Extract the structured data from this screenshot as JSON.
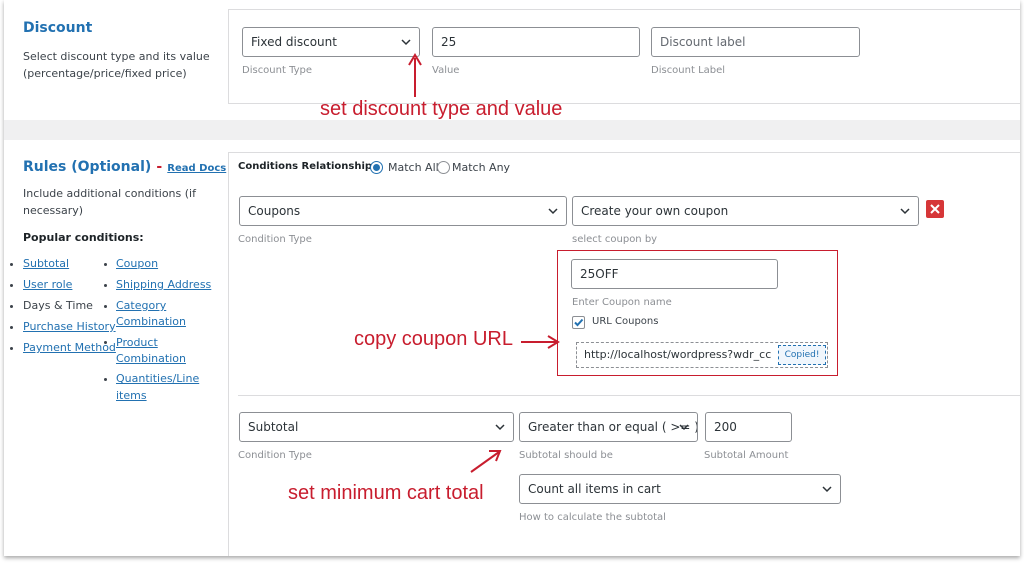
{
  "discount": {
    "title": "Discount",
    "description_line1": "Select discount type and its value",
    "description_line2": "(percentage/price/fixed price)",
    "type_value": "Fixed discount",
    "type_label": "Discount Type",
    "value": "25",
    "value_label": "Value",
    "label_placeholder": "Discount label",
    "label_label": "Discount Label"
  },
  "rules": {
    "title": "Rules (Optional)",
    "dash": "-",
    "read_docs": "Read Docs",
    "description_line1": "Include additional conditions (if",
    "description_line2": "necessary)",
    "popular_heading": "Popular conditions:",
    "popular_left": [
      "Subtotal",
      "User role",
      "Days & Time",
      "Purchase History",
      "Payment Method"
    ],
    "popular_right": [
      "Coupon",
      "Shipping Address",
      "Category",
      "Combination",
      "Product",
      "Combination",
      "Quantities/Line",
      "items"
    ],
    "conditions_relationship_label": "Conditions Relationship",
    "match_all": "Match All",
    "match_any": "Match Any",
    "match_selected": "all"
  },
  "condition1": {
    "type_value": "Coupons",
    "type_label": "Condition Type",
    "select_by_value": "Create your own coupon",
    "select_by_label": "select coupon by",
    "coupon_name": "25OFF",
    "coupon_name_label": "Enter Coupon name",
    "url_coupons_label": "URL Coupons",
    "url_coupons_checked": true,
    "url_value": "http://localhost/wordpress?wdr_cc",
    "copied_label": "Copied!"
  },
  "condition2": {
    "type_value": "Subtotal",
    "type_label": "Condition Type",
    "operator_value": "Greater than or equal ( >= )",
    "operator_label": "Subtotal should be",
    "amount": "200",
    "amount_label": "Subtotal Amount",
    "calc_value": "Count all items in cart",
    "calc_label": "How to calculate the subtotal"
  },
  "annotations": {
    "discount": "set discount type and value",
    "coupon": "copy coupon URL",
    "minimum": "set minimum cart total"
  },
  "colors": {
    "accent": "#2271b1",
    "annotation": "#c81d2e",
    "remove": "#d63638"
  }
}
